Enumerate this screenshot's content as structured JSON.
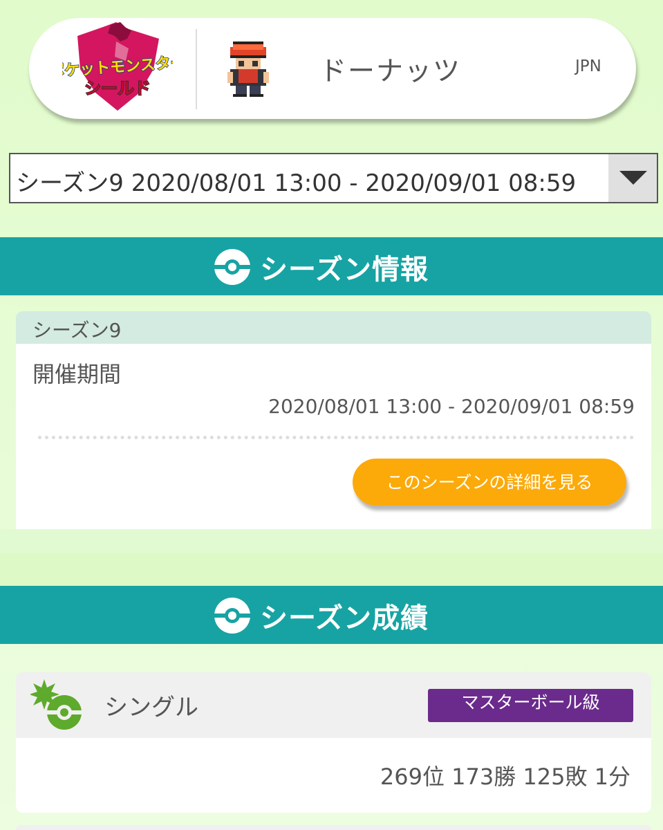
{
  "header": {
    "game_logo": {
      "line1": "ポケットモンスター",
      "line2": "シールド"
    },
    "trainer_name": "ドーナッツ",
    "region": "JPN"
  },
  "season_select": {
    "selected": "シーズン9 2020/08/01 13:00 - 2020/09/01 08:59"
  },
  "season_info": {
    "section_title": "シーズン情報",
    "card_title": "シーズン9",
    "period_label": "開催期間",
    "period_value": "2020/08/01 13:00 - 2020/09/01 08:59",
    "detail_button": "このシーズンの詳細を見る"
  },
  "season_results": {
    "section_title": "シーズン成績",
    "battle_type": "シングル",
    "rank_class": "マスターボール級",
    "summary": "269位 173勝 125敗 1分"
  },
  "colors": {
    "teal": "#17a3a3",
    "orange_button": "#fcaa0a",
    "purple_badge": "#6a2b8c",
    "background": "#e3fbce"
  }
}
